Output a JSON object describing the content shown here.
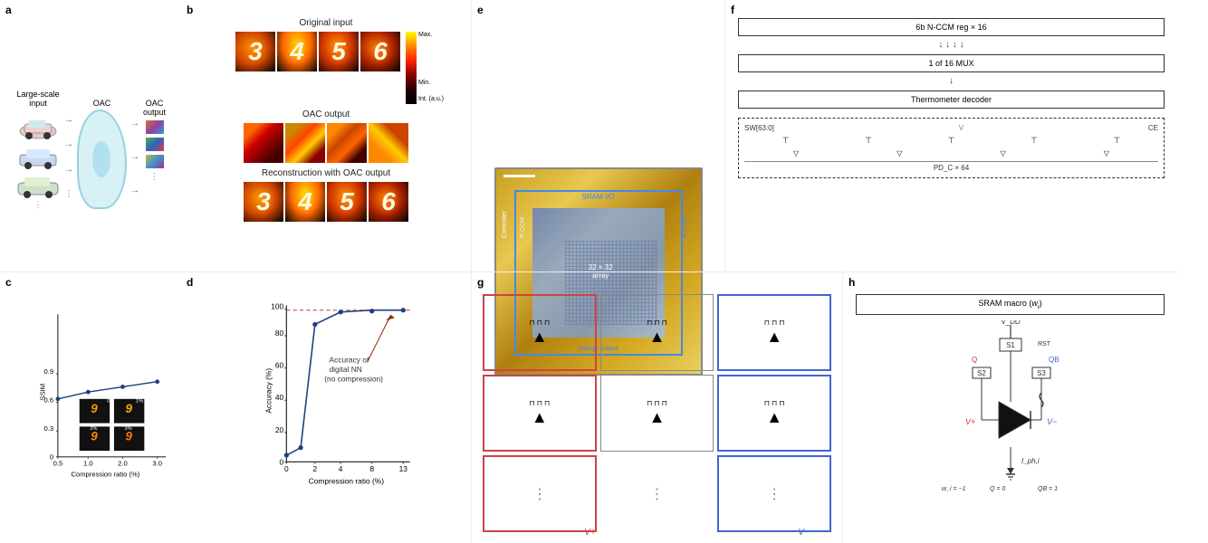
{
  "panels": {
    "a": {
      "label": "a",
      "title_large_scale": "Large-scale\ninput",
      "title_oac": "OAC",
      "title_output": "OAC\noutput"
    },
    "b": {
      "label": "b",
      "original_input": "Original input",
      "oac_output": "OAC output",
      "reconstruction": "Reconstruction with OAC output",
      "colorbar_max": "Max.",
      "colorbar_min": "Min.",
      "colorbar_unit": "Int. (a.u.)",
      "digits": [
        "3",
        "4",
        "5",
        "6"
      ]
    },
    "c": {
      "label": "c",
      "y_axis": "SSIM",
      "x_axis": "Compression ratio (%)",
      "y_ticks": [
        "0",
        "0.3",
        "0.6",
        "0.9"
      ],
      "x_ticks": [
        "0.5",
        "1.0",
        "2.0",
        "3.0"
      ],
      "thumb_labels": [
        "0.5%",
        "1%",
        "2%",
        "3%"
      ],
      "digit": "9"
    },
    "d": {
      "label": "d",
      "y_axis": "Accuracy (%)",
      "x_axis": "Compression ratio (%)",
      "y_ticks": [
        "0",
        "20",
        "40",
        "60",
        "80",
        "100"
      ],
      "x_ticks": [
        "0",
        "2",
        "4",
        "8",
        "13"
      ],
      "annotation": "Accuracy of\ndigital NN\n(no compression)",
      "dashed_line_value": "99"
    },
    "e": {
      "label": "e",
      "labels": {
        "sram_io": "SRAM I/O",
        "controller": "Controller",
        "p_ccm": "P-CCM",
        "n_ccm": "N-CCM",
        "array": "32 × 32\narray",
        "voltage_output": "Voltage output"
      }
    },
    "f": {
      "label": "f",
      "block1": "6b N-CCM reg × 16",
      "block2": "1 of 16 MUX",
      "block3": "Thermometer   decoder",
      "sw_label": "SW[63:0]",
      "v_label": "V",
      "ce_label": "CE",
      "pd_label": "PD_C × 64"
    },
    "g": {
      "label": "g",
      "v_plus": "V+",
      "v_minus": "V−"
    },
    "h": {
      "label": "h",
      "title": "SRAM macro (w_i)",
      "vdd": "V_DD",
      "q": "Q",
      "qb": "QB",
      "s1": "S1",
      "s2": "S2",
      "s3": "S3",
      "rst": "RST",
      "v_plus": "V+",
      "v_minus": "V−",
      "wi_eq": "w_i = −1",
      "q_eq": "Q = 0",
      "qb_eq": "QB = 1",
      "i_ph": "I_ph,i"
    }
  }
}
